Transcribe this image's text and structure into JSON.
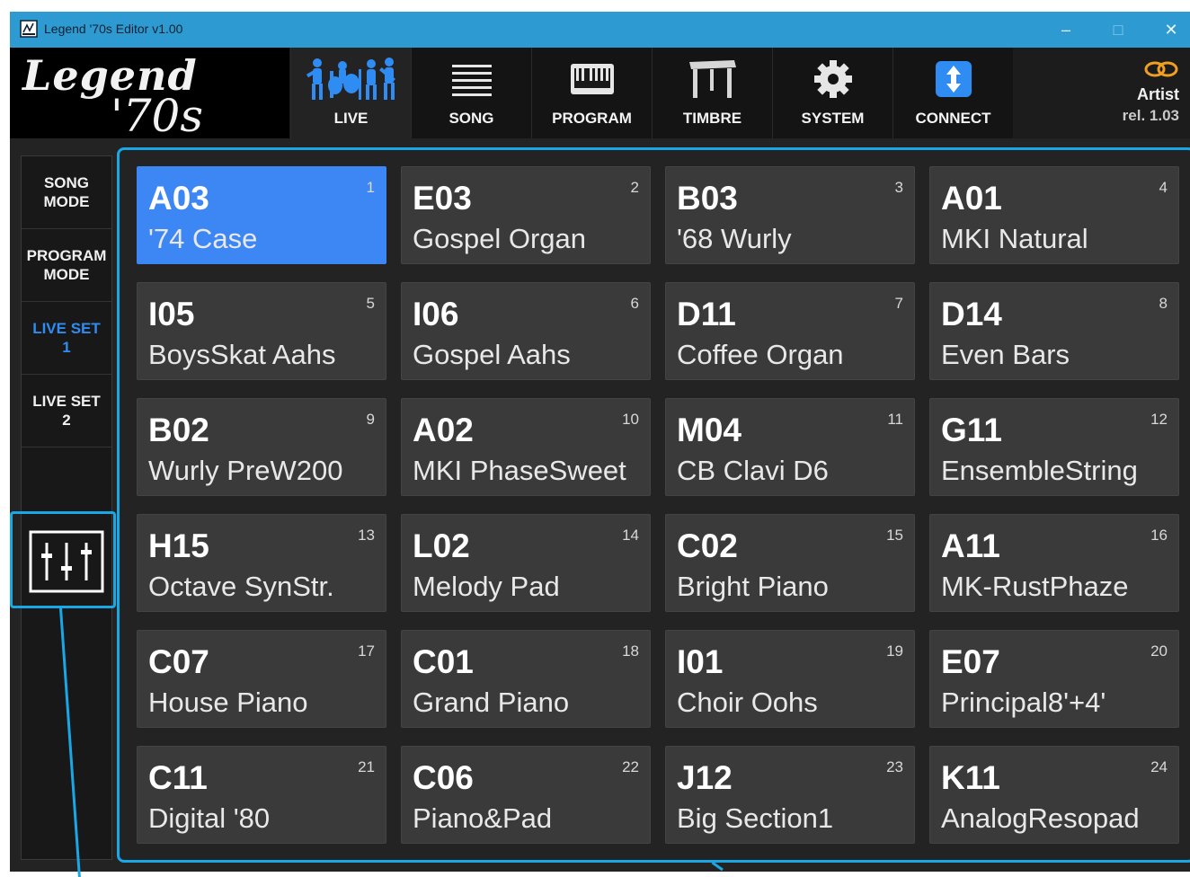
{
  "window": {
    "title": "Legend '70s Editor v1.00",
    "minimize": "–",
    "maximize": "□",
    "close": "✕"
  },
  "logo": {
    "line1": "Legend",
    "line2": "'70s"
  },
  "tabs": [
    {
      "label": "LIVE",
      "icon": "band-icon"
    },
    {
      "label": "SONG",
      "icon": "list-icon"
    },
    {
      "label": "PROGRAM",
      "icon": "keyboard-icon"
    },
    {
      "label": "TIMBRE",
      "icon": "piano-icon"
    },
    {
      "label": "SYSTEM",
      "icon": "gear-icon"
    },
    {
      "label": "CONNECT",
      "icon": "usb-icon"
    }
  ],
  "artist": {
    "name": "Artist",
    "release": "rel. 1.03",
    "icon": "link-icon"
  },
  "sidebar": {
    "items": [
      {
        "label": "SONG\nMODE"
      },
      {
        "label": "PROGRAM\nMODE"
      },
      {
        "label": "LIVE SET\n1"
      },
      {
        "label": "LIVE SET\n2"
      }
    ],
    "mixer_icon": "mixer-icon"
  },
  "pads": [
    {
      "code": "A03",
      "name": "'74 Case",
      "num": "1"
    },
    {
      "code": "E03",
      "name": "Gospel Organ",
      "num": "2"
    },
    {
      "code": "B03",
      "name": "'68 Wurly",
      "num": "3"
    },
    {
      "code": "A01",
      "name": "MKI Natural",
      "num": "4"
    },
    {
      "code": "I05",
      "name": "BoysSkat Aahs",
      "num": "5"
    },
    {
      "code": "I06",
      "name": "Gospel Aahs",
      "num": "6"
    },
    {
      "code": "D11",
      "name": "Coffee Organ",
      "num": "7"
    },
    {
      "code": "D14",
      "name": "Even Bars",
      "num": "8"
    },
    {
      "code": "B02",
      "name": "Wurly PreW200",
      "num": "9"
    },
    {
      "code": "A02",
      "name": "MKI PhaseSweet",
      "num": "10"
    },
    {
      "code": "M04",
      "name": "CB Clavi D6",
      "num": "11"
    },
    {
      "code": "G11",
      "name": "EnsembleString",
      "num": "12"
    },
    {
      "code": "H15",
      "name": "Octave SynStr.",
      "num": "13"
    },
    {
      "code": "L02",
      "name": "Melody Pad",
      "num": "14"
    },
    {
      "code": "C02",
      "name": "Bright Piano",
      "num": "15"
    },
    {
      "code": "A11",
      "name": "MK-RustPhaze",
      "num": "16"
    },
    {
      "code": "C07",
      "name": "House Piano",
      "num": "17"
    },
    {
      "code": "C01",
      "name": "Grand Piano",
      "num": "18"
    },
    {
      "code": "I01",
      "name": "Choir Oohs",
      "num": "19"
    },
    {
      "code": "E07",
      "name": "Principal8'+4'",
      "num": "20"
    },
    {
      "code": "C11",
      "name": "Digital '80",
      "num": "21"
    },
    {
      "code": "C06",
      "name": "Piano&Pad",
      "num": "22"
    },
    {
      "code": "J12",
      "name": "Big Section1",
      "num": "23"
    },
    {
      "code": "K11",
      "name": "AnalogResopad",
      "num": "24"
    }
  ],
  "colors": {
    "accent": "#2d9bd1",
    "selected_pad": "#3d87f5",
    "callout": "#1aa7e6",
    "live_set": "#2f8cf2"
  }
}
